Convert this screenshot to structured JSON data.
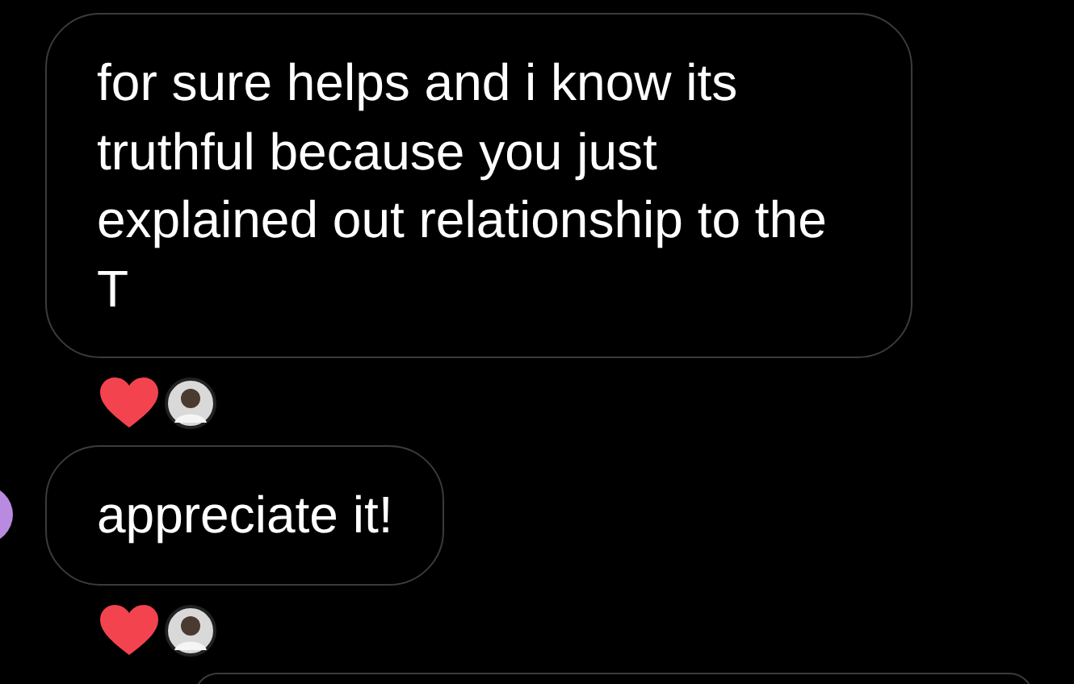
{
  "messages": [
    {
      "kind": "text",
      "text": "for sure helps and i know its truthful because you just explained out relationship to the T",
      "sender_avatar": false,
      "reactions": [
        {
          "kind": "heart"
        },
        {
          "kind": "avatar"
        }
      ]
    },
    {
      "kind": "text",
      "text": "appreciate it!",
      "sender_avatar": true,
      "reactions": [
        {
          "kind": "heart"
        },
        {
          "kind": "avatar"
        }
      ]
    },
    {
      "kind": "partial"
    }
  ]
}
